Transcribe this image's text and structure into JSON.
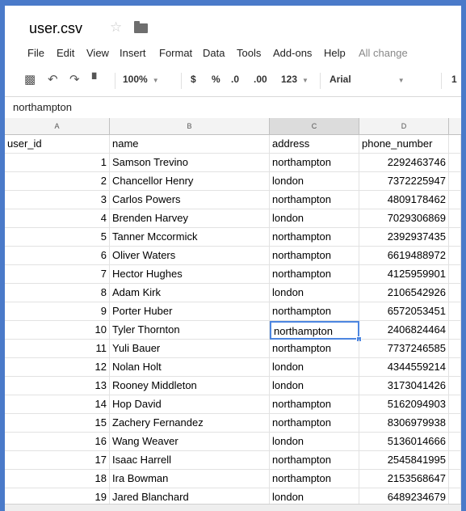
{
  "file": {
    "title": "user.csv"
  },
  "menu": {
    "items": [
      "File",
      "Edit",
      "View",
      "Insert",
      "Format",
      "Data",
      "Tools",
      "Add-ons",
      "Help"
    ],
    "status": "All change"
  },
  "toolbar": {
    "zoom": "100%",
    "currency": "$",
    "percent": "%",
    "decrease_decimals": ".0",
    "increase_decimals": ".00",
    "more_formats": "123",
    "font": "Arial",
    "font_size": "1"
  },
  "formula_bar": {
    "value": "northampton"
  },
  "columns": [
    "A",
    "B",
    "C",
    "D"
  ],
  "header": [
    "user_id",
    "name",
    "address",
    "phone_number"
  ],
  "rows": [
    [
      "1",
      "Samson Trevino",
      "northampton",
      "2292463746"
    ],
    [
      "2",
      "Chancellor Henry",
      "london",
      "7372225947"
    ],
    [
      "3",
      "Carlos Powers",
      "northampton",
      "4809178462"
    ],
    [
      "4",
      "Brenden Harvey",
      "london",
      "7029306869"
    ],
    [
      "5",
      "Tanner Mccormick",
      "northampton",
      "2392937435"
    ],
    [
      "6",
      "Oliver Waters",
      "northampton",
      "6619488972"
    ],
    [
      "7",
      "Hector Hughes",
      "northampton",
      "4125959901"
    ],
    [
      "8",
      "Adam Kirk",
      "london",
      "2106542926"
    ],
    [
      "9",
      "Porter Huber",
      "northampton",
      "6572053451"
    ],
    [
      "10",
      "Tyler Thornton",
      "northampton",
      "2406824464"
    ],
    [
      "11",
      "Yuli Bauer",
      "northampton",
      "7737246585"
    ],
    [
      "12",
      "Nolan Holt",
      "london",
      "4344559214"
    ],
    [
      "13",
      "Rooney Middleton",
      "london",
      "3173041426"
    ],
    [
      "14",
      "Hop David",
      "northampton",
      "5162094903"
    ],
    [
      "15",
      "Zachery Fernandez",
      "northampton",
      "8306979938"
    ],
    [
      "16",
      "Wang Weaver",
      "london",
      "5136014666"
    ],
    [
      "17",
      "Isaac Harrell",
      "northampton",
      "2545841995"
    ],
    [
      "18",
      "Ira Bowman",
      "northampton",
      "2153568647"
    ],
    [
      "19",
      "Jared Blanchard",
      "london",
      "6489234679"
    ]
  ],
  "selection": {
    "column": "C",
    "row": "10"
  }
}
